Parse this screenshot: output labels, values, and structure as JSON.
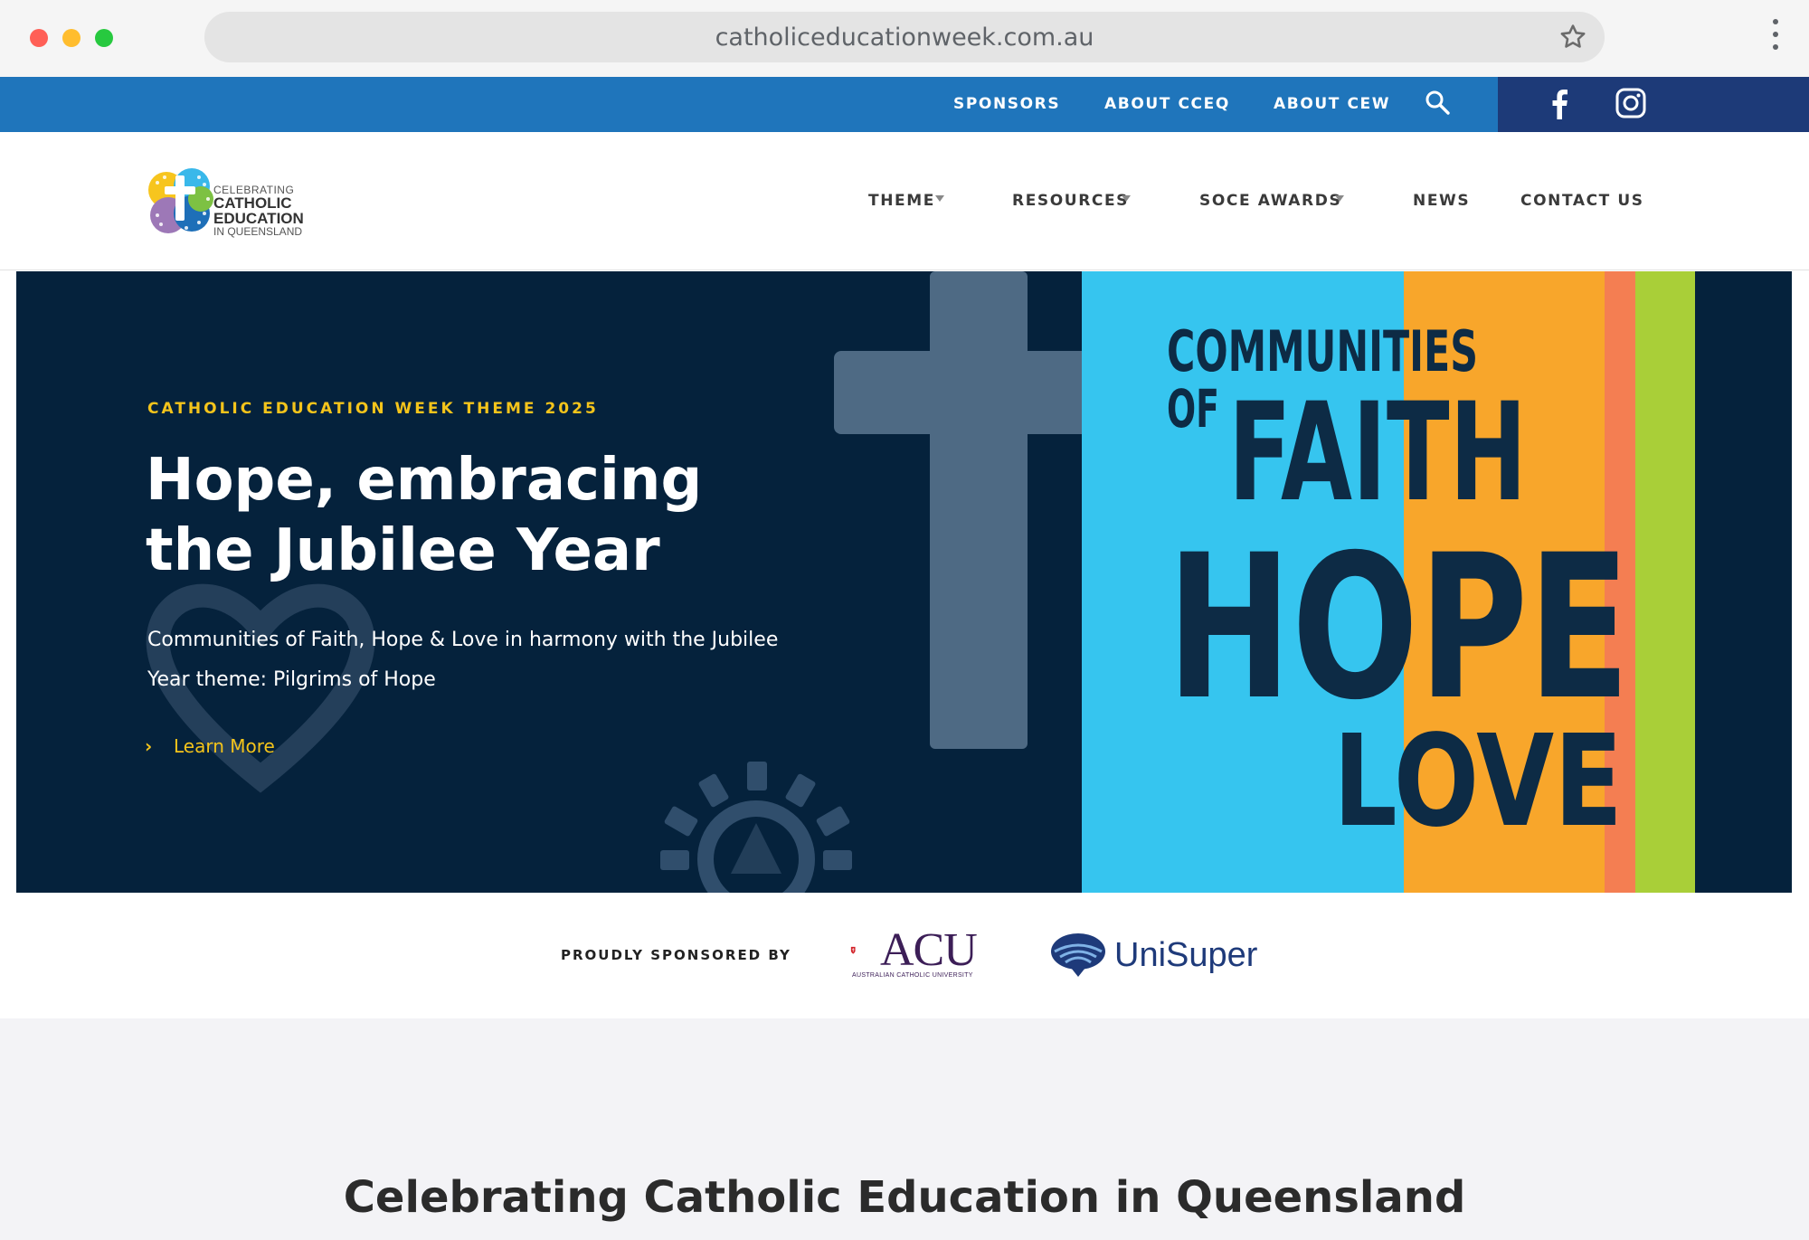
{
  "browser": {
    "url": "catholiceducationweek.com.au"
  },
  "topbar": {
    "links": [
      "SPONSORS",
      "ABOUT CCEQ",
      "ABOUT CEW"
    ],
    "search_icon": "search-icon",
    "social": [
      "facebook-icon",
      "instagram-icon"
    ],
    "color": "#1f75bb",
    "social_bg": "#1d3a78"
  },
  "logo": {
    "line1": "CELEBRATING",
    "line2": "CATHOLIC",
    "line3": "EDUCATION",
    "line4": "IN QUEENSLAND"
  },
  "nav": {
    "items": [
      {
        "label": "THEME",
        "dropdown": true
      },
      {
        "label": "RESOURCES",
        "dropdown": true
      },
      {
        "label": "SOCE AWARDS",
        "dropdown": true
      },
      {
        "label": "NEWS",
        "dropdown": false
      },
      {
        "label": "CONTACT US",
        "dropdown": false
      }
    ]
  },
  "hero": {
    "eyebrow": "CATHOLIC EDUCATION WEEK THEME 2025",
    "title_line1": "Hope, embracing",
    "title_line2": "the Jubilee Year",
    "subtitle_line1": "Communities of Faith, Hope & Love in harmony with the Jubilee",
    "subtitle_line2": "Year theme: Pilgrims of Hope",
    "cta": "Learn More",
    "artwork": {
      "word1": "COMMUNITIES",
      "word2": "OF",
      "word3": "FAITH",
      "word4": "HOPE",
      "word5": "LOVE"
    },
    "bg": "#05223c",
    "accent": "#f4c41b",
    "stripe_colors": [
      "#36c5ef",
      "#f8a62b",
      "#f47e52",
      "#a9cf38"
    ]
  },
  "sponsors": {
    "label": "PROUDLY SPONSORED BY",
    "acu": {
      "name": "ACU",
      "sub": "AUSTRALIAN CATHOLIC UNIVERSITY"
    },
    "unisuper": {
      "name": "UniSuper"
    }
  },
  "section": {
    "title": "Celebrating Catholic Education in Queensland"
  }
}
